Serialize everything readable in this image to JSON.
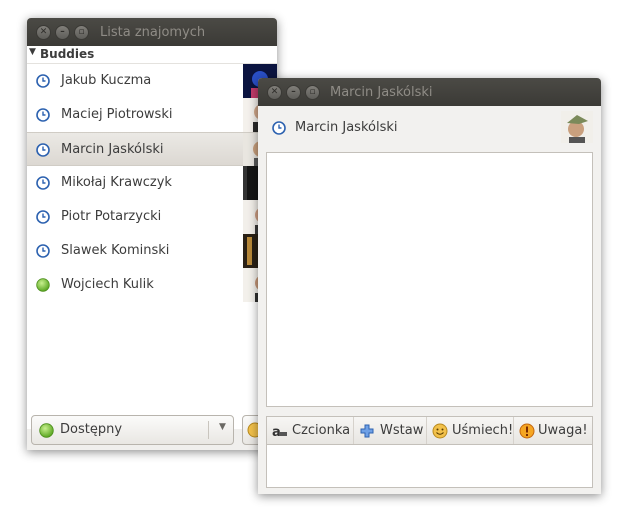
{
  "buddy_window": {
    "title": "Lista znajomych",
    "group": {
      "label": "Buddies"
    },
    "buddies": [
      {
        "name": "Jakub Kuczma",
        "status": "away"
      },
      {
        "name": "Maciej Piotrowski",
        "status": "away"
      },
      {
        "name": "Marcin Jaskólski",
        "status": "away",
        "selected": true
      },
      {
        "name": "Mikołaj Krawczyk",
        "status": "away"
      },
      {
        "name": "Piotr Potarzycki",
        "status": "away"
      },
      {
        "name": "Slawek Kominski",
        "status": "away"
      },
      {
        "name": "Wojciech Kulik",
        "status": "available"
      }
    ],
    "status_selector": {
      "label": "Dostępny",
      "color": "#6fc02c"
    }
  },
  "chat_window": {
    "title": "Marcin Jaskólski",
    "contact_name": "Marcin Jaskólski",
    "toolbar": {
      "font_label": "Czcionka",
      "insert_label": "Wstaw",
      "smile_label": "Uśmiech!",
      "attention_label": "Uwaga!"
    }
  },
  "colors": {
    "titlebar": "#3f3e3a",
    "away_icon": "#2d62b0",
    "available_icon": "#6fc02c",
    "selection": "#e2dfda"
  }
}
